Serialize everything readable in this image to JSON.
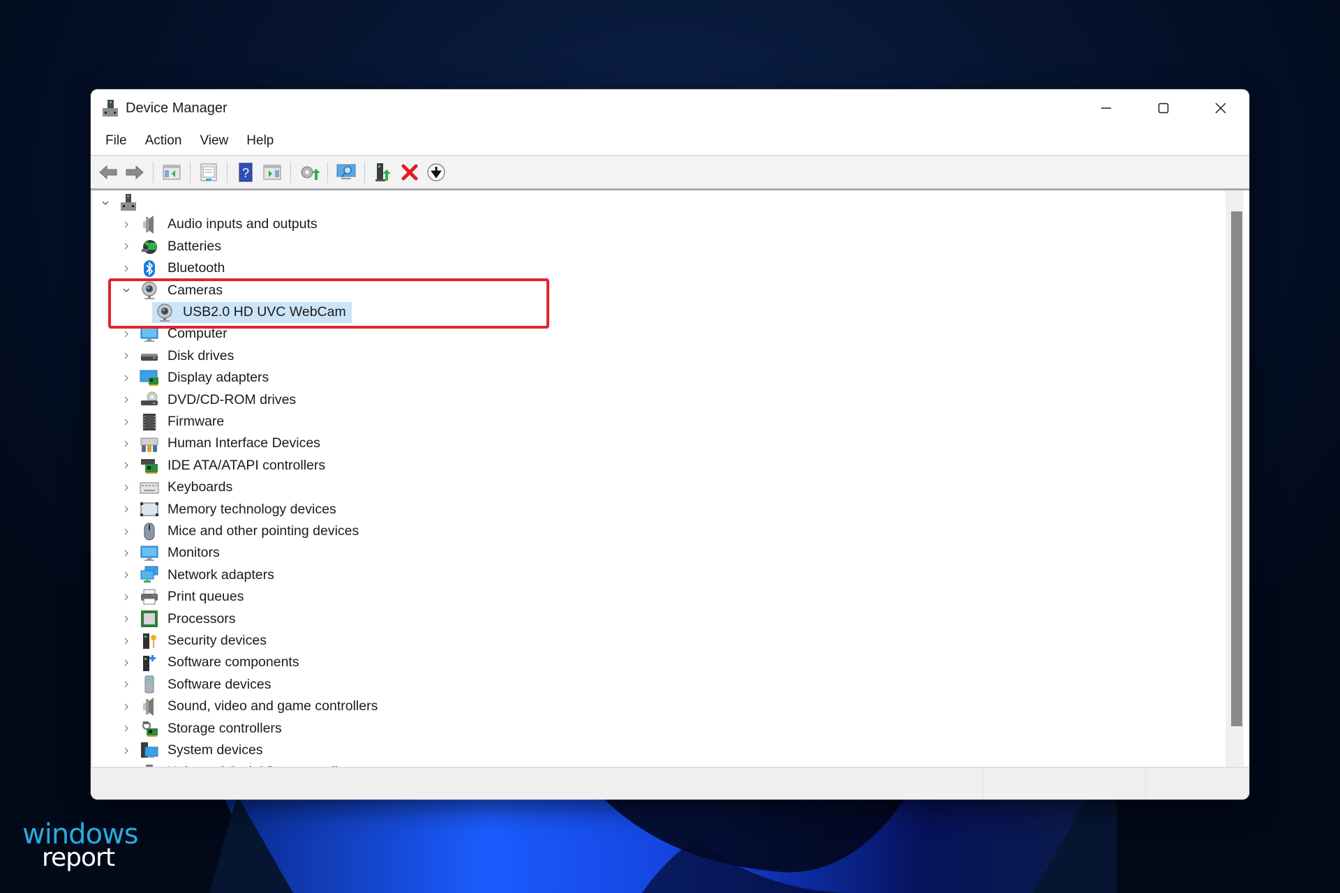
{
  "window": {
    "title": "Device Manager",
    "caption_buttons": [
      {
        "name": "minimize",
        "icon": "minimize-icon"
      },
      {
        "name": "maximize",
        "icon": "maximize-icon"
      },
      {
        "name": "close",
        "icon": "close-icon"
      }
    ]
  },
  "menubar": {
    "items": [
      "File",
      "Action",
      "View",
      "Help"
    ]
  },
  "toolbar": {
    "buttons": [
      {
        "icon": "back-arrow-icon",
        "label": "Back"
      },
      {
        "icon": "forward-arrow-icon",
        "label": "Forward"
      },
      {
        "icon": "show-hide-console-tree-icon",
        "label": "Show/Hide Console Tree"
      },
      {
        "icon": "properties-icon",
        "label": "Properties"
      },
      {
        "icon": "help-icon",
        "label": "Help"
      },
      {
        "icon": "show-action-pane-icon",
        "label": "Show/Hide Action Pane"
      },
      {
        "icon": "update-driver-icon",
        "label": "Update driver"
      },
      {
        "icon": "scan-hardware-changes-icon",
        "label": "Scan for hardware changes"
      },
      {
        "icon": "add-legacy-hardware-icon",
        "label": "Add drivers"
      },
      {
        "icon": "uninstall-device-icon",
        "label": "Uninstall device"
      },
      {
        "icon": "disable-device-icon",
        "label": "Disable device"
      }
    ]
  },
  "tree": {
    "root": {
      "label": "",
      "icon": "computer-root-icon",
      "expanded": true
    },
    "categories": [
      {
        "label": "Audio inputs and outputs",
        "icon": "speaker-icon",
        "expanded": false
      },
      {
        "label": "Batteries",
        "icon": "battery-icon",
        "expanded": false
      },
      {
        "label": "Bluetooth",
        "icon": "bluetooth-icon",
        "expanded": false
      },
      {
        "label": "Cameras",
        "icon": "webcam-icon",
        "expanded": true,
        "children": [
          {
            "label": "USB2.0 HD UVC WebCam",
            "icon": "webcam-icon",
            "selected": true
          }
        ]
      },
      {
        "label": "Computer",
        "icon": "monitor-icon",
        "expanded": false
      },
      {
        "label": "Disk drives",
        "icon": "disk-drive-icon",
        "expanded": false
      },
      {
        "label": "Display adapters",
        "icon": "display-adapter-icon",
        "expanded": false
      },
      {
        "label": "DVD/CD-ROM drives",
        "icon": "dvd-drive-icon",
        "expanded": false
      },
      {
        "label": "Firmware",
        "icon": "firmware-chip-icon",
        "expanded": false
      },
      {
        "label": "Human Interface Devices",
        "icon": "hid-icon",
        "expanded": false
      },
      {
        "label": "IDE ATA/ATAPI controllers",
        "icon": "ide-controller-icon",
        "expanded": false
      },
      {
        "label": "Keyboards",
        "icon": "keyboard-icon",
        "expanded": false
      },
      {
        "label": "Memory technology devices",
        "icon": "memory-device-icon",
        "expanded": false
      },
      {
        "label": "Mice and other pointing devices",
        "icon": "mouse-icon",
        "expanded": false
      },
      {
        "label": "Monitors",
        "icon": "monitor-icon",
        "expanded": false
      },
      {
        "label": "Network adapters",
        "icon": "network-adapter-icon",
        "expanded": false
      },
      {
        "label": "Print queues",
        "icon": "printer-icon",
        "expanded": false
      },
      {
        "label": "Processors",
        "icon": "processor-icon",
        "expanded": false
      },
      {
        "label": "Security devices",
        "icon": "security-key-icon",
        "expanded": false
      },
      {
        "label": "Software components",
        "icon": "software-component-icon",
        "expanded": false
      },
      {
        "label": "Software devices",
        "icon": "software-device-icon",
        "expanded": false
      },
      {
        "label": "Sound, video and game controllers",
        "icon": "speaker-icon",
        "expanded": false
      },
      {
        "label": "Storage controllers",
        "icon": "storage-controller-icon",
        "expanded": false
      },
      {
        "label": "System devices",
        "icon": "system-devices-icon",
        "expanded": false
      },
      {
        "label": "Universal Serial Bus controllers",
        "icon": "usb-icon",
        "expanded": false,
        "partially_visible": true
      }
    ]
  },
  "annotation": {
    "highlight_color": "#e0242d",
    "target": "Cameras"
  },
  "colors": {
    "selection": "#cce4f7",
    "brand_blue": "#2aa9e0"
  },
  "brand": {
    "top": "windows",
    "bottom": "report"
  }
}
